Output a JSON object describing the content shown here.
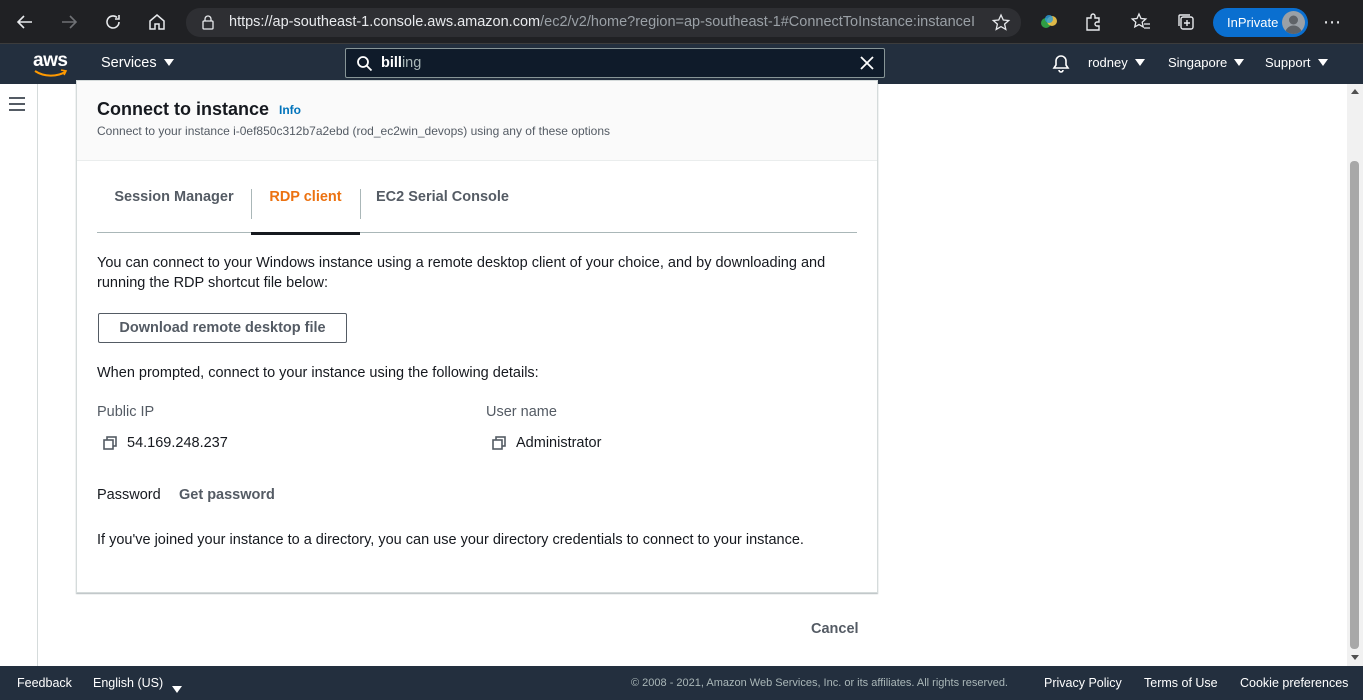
{
  "browser": {
    "url_host": "https://ap-southeast-1.console.aws.amazon.com",
    "url_path": "/ec2/v2/home?region=ap-southeast-1#ConnectToInstance:instanceId=...",
    "inprivate_label": "InPrivate"
  },
  "aws_nav": {
    "logo": "aws",
    "services_label": "Services",
    "search_typed": "bill",
    "search_suggest": "ing",
    "user_label": "rodney",
    "region_label": "Singapore",
    "support_label": "Support"
  },
  "panel": {
    "title": "Connect to instance",
    "info_label": "Info",
    "description": "Connect to your instance i-0ef850c312b7a2ebd (rod_ec2win_devops) using any of these options",
    "tabs": [
      {
        "label": "Session Manager",
        "active": false
      },
      {
        "label": "RDP client",
        "active": true
      },
      {
        "label": "EC2 Serial Console",
        "active": false
      }
    ],
    "intro_line1": "You can connect to your Windows instance using a remote desktop client of your choice, and by downloading and",
    "intro_line2": "running the RDP shortcut file below:",
    "download_button": "Download remote desktop file",
    "prompt_text": "When prompted, connect to your instance using the following details:",
    "public_ip_label": "Public IP",
    "public_ip_value": "54.169.248.237",
    "username_label": "User name",
    "username_value": "Administrator",
    "password_label": "Password",
    "get_password_label": "Get password",
    "directory_text": "If you've joined your instance to a directory, you can use your directory credentials to connect to your instance."
  },
  "cancel_label": "Cancel",
  "footer": {
    "feedback": "Feedback",
    "language": "English (US)",
    "copyright": "© 2008 - 2021, Amazon Web Services, Inc. or its affiliates. All rights reserved.",
    "privacy": "Privacy Policy",
    "terms": "Terms of Use",
    "cookies": "Cookie preferences"
  },
  "colors": {
    "aws_nav_bg": "#232f3e",
    "active_tab": "#ec7211",
    "link": "#0073bb",
    "inprivate": "#0a6fd0"
  }
}
